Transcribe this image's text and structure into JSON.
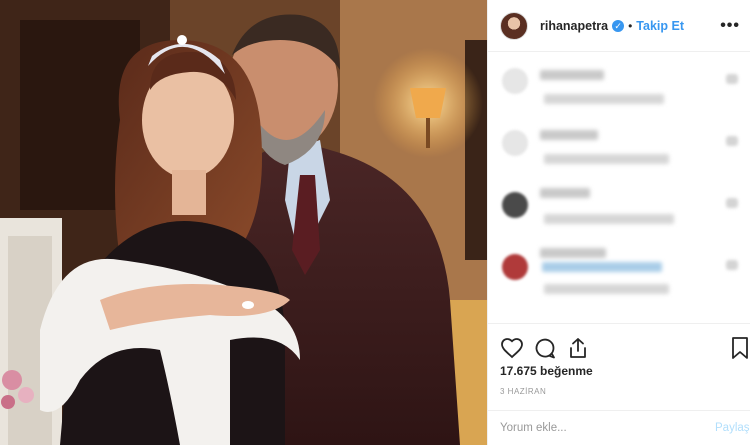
{
  "post": {
    "photo_alt": "",
    "photo_icon": "photo-image"
  },
  "header": {
    "username": "rihanapetra",
    "verified_icon": "verified-badge-icon",
    "separator": "•",
    "follow_label": "Takip Et",
    "more_icon": "more-options-icon",
    "more_label": "•••"
  },
  "comments": [
    {
      "avatar_color": "#e6e6e6"
    },
    {
      "avatar_color": "#e6e6e6"
    },
    {
      "avatar_color": "#4a4a4a"
    },
    {
      "avatar_color": "#b03a3a"
    }
  ],
  "actions": {
    "like_icon": "heart-icon",
    "comment_icon": "comment-bubble-icon",
    "share_icon": "share-icon",
    "save_icon": "bookmark-icon"
  },
  "likes_text": "17.675 beğenme",
  "date_text": "3 HAZİRAN",
  "add_comment": {
    "placeholder": "Yorum ekle...",
    "post_label": "Paylaş"
  },
  "colors": {
    "link_blue": "#3897f0",
    "muted_text": "#999999",
    "divider": "#efefef"
  }
}
